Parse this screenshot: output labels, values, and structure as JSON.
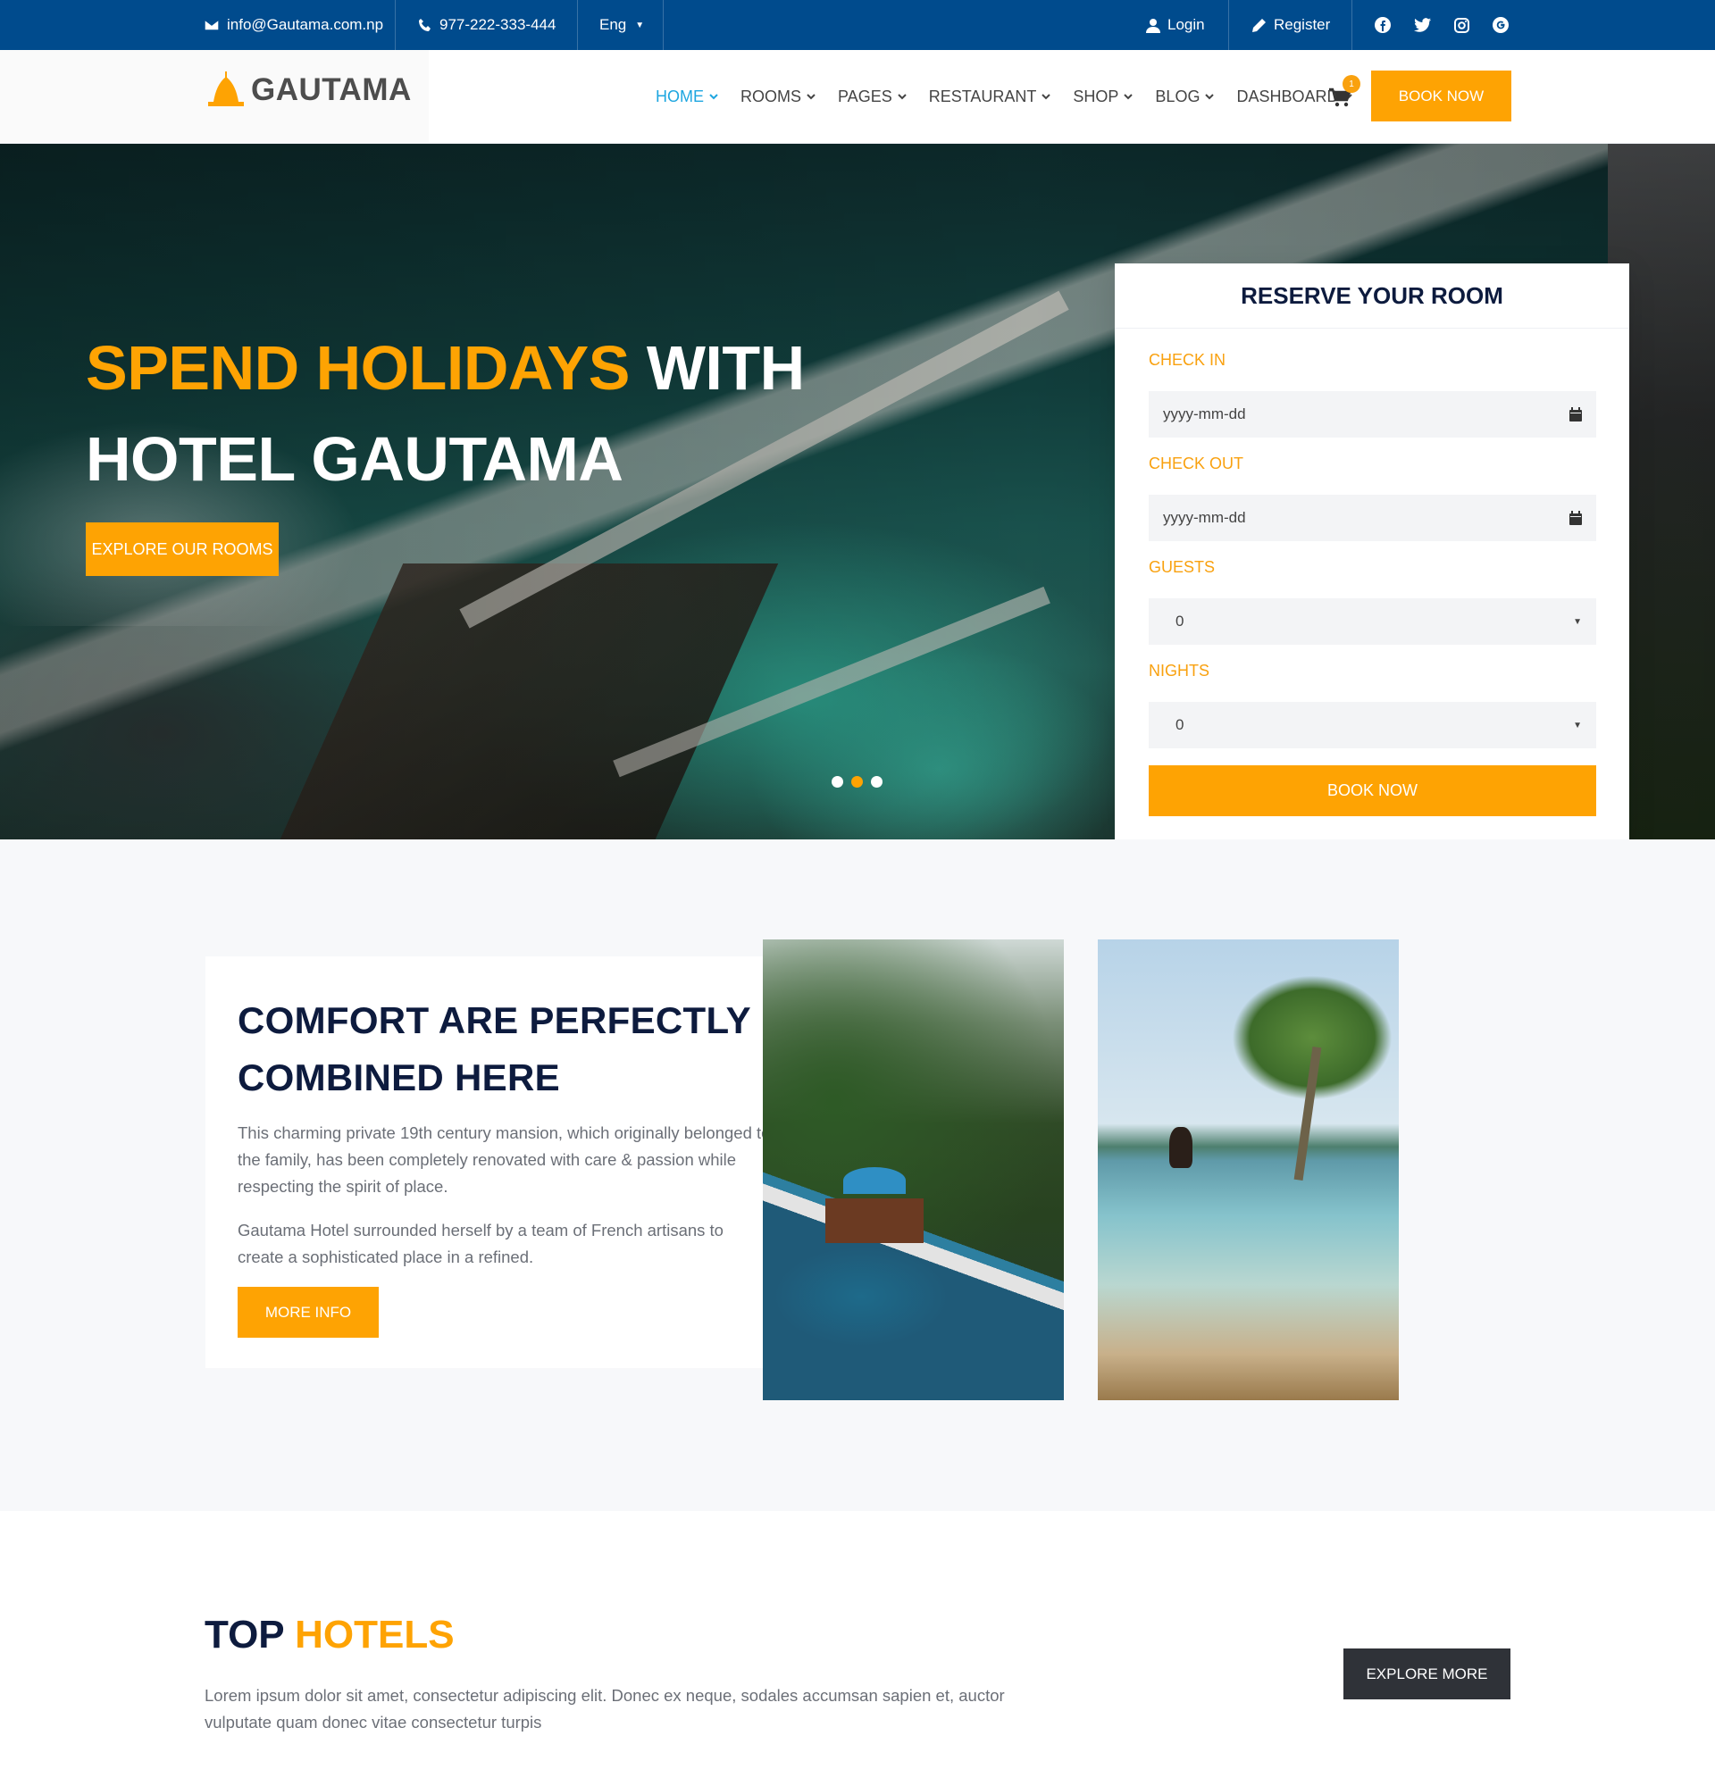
{
  "topbar": {
    "email": "info@Gautama.com.np",
    "phone": "977-222-333-444",
    "language": "Eng",
    "login": "Login",
    "register": "Register",
    "social_icons": [
      "facebook-icon",
      "twitter-icon",
      "instagram-icon",
      "google-icon"
    ]
  },
  "header": {
    "logo_text": "GAUTAMA",
    "nav": [
      {
        "label": "HOME",
        "active": true
      },
      {
        "label": "ROOMS",
        "active": false
      },
      {
        "label": "PAGES",
        "active": false
      },
      {
        "label": "RESTAURANT",
        "active": false
      },
      {
        "label": "SHOP",
        "active": false
      },
      {
        "label": "BLOG",
        "active": false
      },
      {
        "label": "DASHBOARD",
        "active": false
      }
    ],
    "cart_count": "1",
    "book_now": "BOOK NOW"
  },
  "hero": {
    "title_accent": "SPEND HOLIDAYS",
    "title_rest": "WITH",
    "title_line2": "HOTEL GAUTAMA",
    "button": "EXPLORE OUR ROOMS",
    "slides": 3,
    "active_slide": 2
  },
  "reserve": {
    "title": "RESERVE YOUR ROOM",
    "check_in_label": "CHECK IN",
    "check_in_value": "yyyy-mm-dd",
    "check_out_label": "CHECK OUT",
    "check_out_value": "yyyy-mm-dd",
    "guests_label": "GUESTS",
    "guests_value": "0",
    "nights_label": "NIGHTS",
    "nights_value": "0",
    "book_now": "BOOK NOW"
  },
  "about": {
    "title_line1": "COMFORT ARE PERFECTLY",
    "title_line2": "COMBINED HERE",
    "paragraph1": "This charming private 19th century mansion, which originally belonged to the family, has been completely renovated with care & passion while respecting the spirit of place.",
    "paragraph2": "Gautama Hotel surrounded herself by a team of French artisans to create a sophisticated place in a refined.",
    "button": "MORE INFO"
  },
  "top_hotels": {
    "title_dark": "TOP",
    "title_accent": "HOTELS",
    "description": "Lorem ipsum dolor sit amet, consectetur adipiscing elit. Donec ex neque, sodales accumsan sapien et, auctor vulputate quam donec vitae consectetur turpis",
    "button": "EXPLORE MORE"
  },
  "colors": {
    "topbar_bg": "#004b8d",
    "accent_orange": "#fea303",
    "nav_active": "#1ea6e0",
    "heading_dark": "#0d1b3e",
    "dark_button": "#2f3238"
  }
}
